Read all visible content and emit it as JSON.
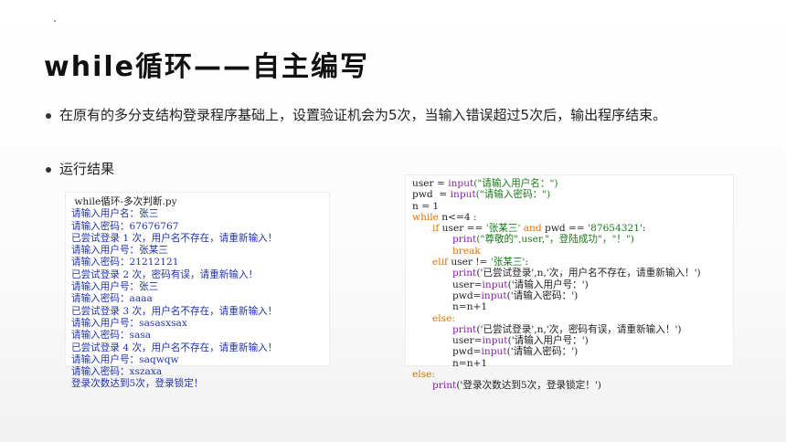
{
  "slide": {
    "title": "while循环——自主编写",
    "bullets": [
      "在原有的多分支结构登录程序基础上，设置验证机会为5次，当输入错误超过5次后，输出程序结束。",
      "运行结果"
    ]
  },
  "output_panel": {
    "lines": [
      " while循环-多次判断.py",
      "请输入用户名：张三",
      "请输入密码：67676767",
      "已尝试登录 1 次，用户名不存在，请重新输入！",
      "请输入用户号：张某三",
      "请输入密码：21212121",
      "已尝试登录 2 次，密码有误，请重新输入！",
      "请输入用户号：张三",
      "请输入密码：aaaa",
      "已尝试登录 3 次，用户名不存在，请重新输入！",
      "请输入用户号：sasasxsax",
      "请输入密码：sasa",
      "已尝试登录 4 次，用户名不存在，请重新输入！",
      "请输入用户号：saqwqw",
      "请输入密码：xszaxa",
      "登录次数达到5次，登录锁定！"
    ]
  },
  "code_panel": {
    "l01": {
      "a": "user = ",
      "b": "input",
      "c": "(\"请输入用户名：\")"
    },
    "l02": {
      "a": "pwd  = ",
      "b": "input",
      "c": "(\"请输入密码：\")"
    },
    "l03": "n = 1",
    "l04": {
      "kw": "while",
      "rest": " n<=4 :"
    },
    "l05": {
      "kw1": "if",
      "a": " user == ",
      "s1": "'张某三'",
      "kw2": " and",
      "b": " pwd == ",
      "s2": "'87654321'",
      "c": ":"
    },
    "l06": {
      "fn": "print",
      "rest": "(\"尊敬的\",user,\"，登陆成功\"，\"！\")"
    },
    "l07": "break",
    "l08": {
      "kw": "elif",
      "a": " user != ",
      "s": "'张某三'",
      "b": ":"
    },
    "l09": {
      "fn": "print",
      "rest": "('已尝试登录',n,'次，用户名不存在，请重新输入！')"
    },
    "l10": {
      "a": "user=",
      "fn": "input",
      "b": "('请输入用户号：')"
    },
    "l11": {
      "a": "pwd=",
      "fn": "input",
      "b": "('请输入密码：')"
    },
    "l12": "n=n+1",
    "l13": "else:",
    "l14": {
      "fn": "print",
      "rest": "('已尝试登录',n,'次，密码有误，请重新输入！')"
    },
    "l15": {
      "a": "user=",
      "fn": "input",
      "b": "('请输入用户号：')"
    },
    "l16": {
      "a": "pwd=",
      "fn": "input",
      "b": "('请输入密码：')"
    },
    "l17": "n=n+1",
    "l18": "else:",
    "l19": {
      "fn": "print",
      "rest": "('登录次数达到5次，登录锁定！')"
    }
  }
}
